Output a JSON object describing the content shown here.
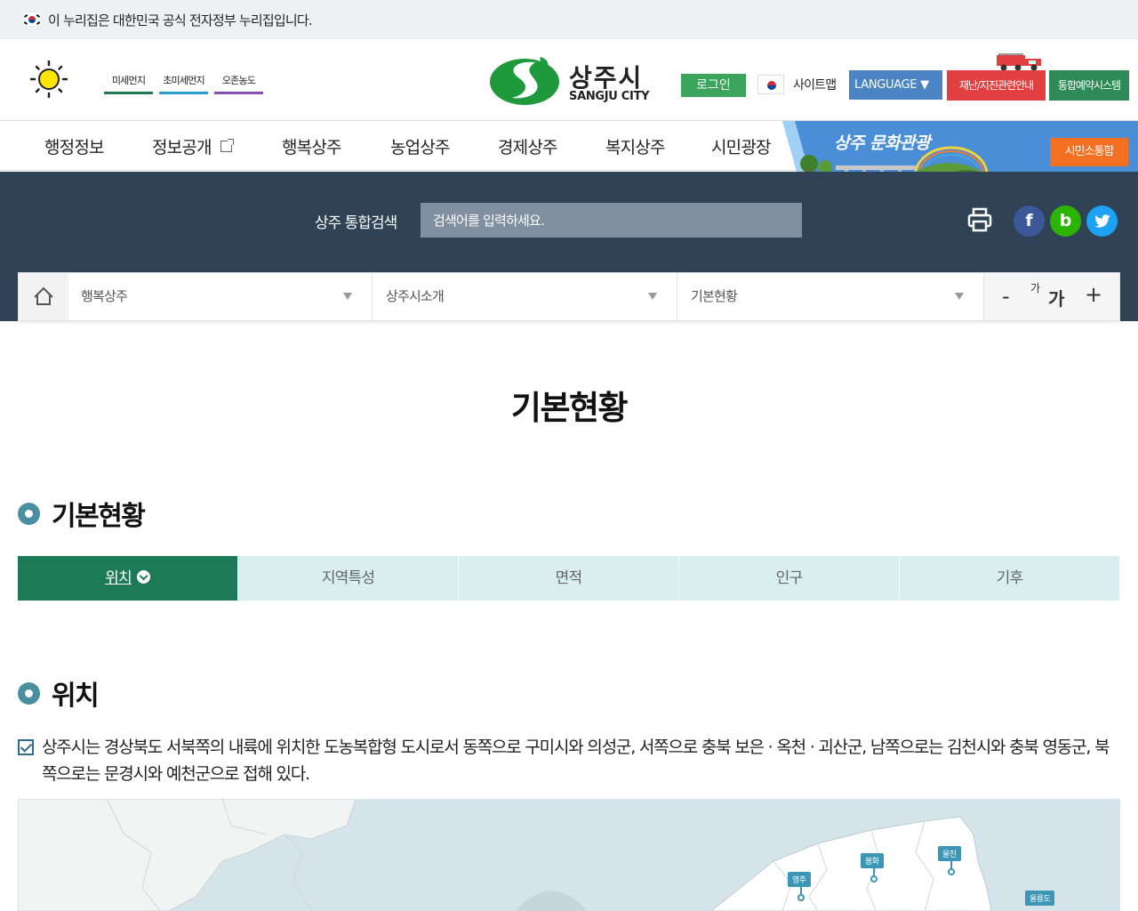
{
  "gov_banner": {
    "text": "이 누리집은 대한민국 공식 전자정부 누리집입니다."
  },
  "header": {
    "air_quality": [
      "미세먼지",
      "초미세먼지",
      "오존농도"
    ],
    "logo": {
      "title": "상주시",
      "subtitle": "SANGJU CITY"
    },
    "login": "로그인",
    "sitemap": "사이트맵",
    "language": "LANGUAGE ▼",
    "disaster": "재난/지진관련안내",
    "reservation": "통합예약시스템"
  },
  "gnb": {
    "items": [
      "행정정보",
      "정보공개",
      "행복상주",
      "농업상주",
      "경제상주",
      "복지상주",
      "시민광장"
    ],
    "banner_text": "상주 문화관광",
    "communication": "시민소통함"
  },
  "search": {
    "label": "상주 통합검색",
    "placeholder": "검색어를 입력하세요."
  },
  "social": {
    "facebook": "f",
    "blog": "b"
  },
  "breadcrumb": {
    "items": [
      "행복상주",
      "상주시소개",
      "기본현황"
    ],
    "font_minus": "-",
    "font_reset_small": "가",
    "font_reset_big": "가",
    "font_plus": "+"
  },
  "content": {
    "page_title": "기본현황",
    "section1_title": "기본현황",
    "tabs": [
      "위치",
      "지역특성",
      "면적",
      "인구",
      "기후"
    ],
    "section2_title": "위치",
    "description": "상주시는 경상북도 서북쪽의 내륙에 위치한 도농복합형 도시로서 동쪽으로 구미시와 의성군, 서쪽으로 충북 보은 · 옥천 · 괴산군, 남쪽으로는 김천시와 충북 영동군, 북쪽으로는 문경시와 예천군으로 접해 있다."
  },
  "map": {
    "pins": [
      "영주",
      "봉화",
      "울진",
      "울릉도"
    ]
  },
  "colors": {
    "primary_green": "#1d7a56",
    "search_band": "#2f4256",
    "tab_inactive": "#d9eeef",
    "disaster_red": "#e24040",
    "lang_blue": "#4a84c4",
    "orange": "#f36f21"
  }
}
